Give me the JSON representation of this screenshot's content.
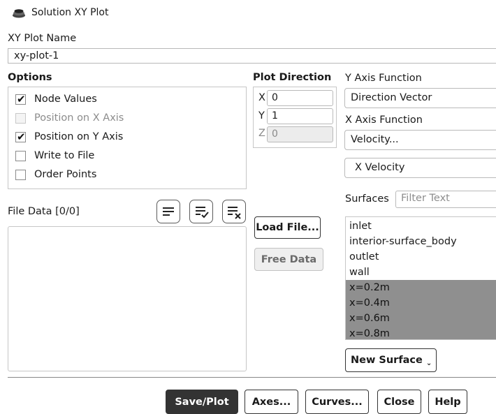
{
  "window": {
    "title": "Solution XY Plot"
  },
  "name": {
    "label": "XY Plot Name",
    "value": "xy-plot-1"
  },
  "options": {
    "title": "Options",
    "items": [
      {
        "label": "Node Values",
        "checked": true,
        "enabled": true
      },
      {
        "label": "Position on X Axis",
        "checked": false,
        "enabled": false
      },
      {
        "label": "Position on Y Axis",
        "checked": true,
        "enabled": true
      },
      {
        "label": "Write to File",
        "checked": false,
        "enabled": true
      },
      {
        "label": "Order Points",
        "checked": false,
        "enabled": true
      }
    ]
  },
  "plot_direction": {
    "title": "Plot Direction",
    "x": {
      "label": "X",
      "value": "0"
    },
    "y": {
      "label": "Y",
      "value": "1"
    },
    "z": {
      "label": "Z",
      "value": "0"
    }
  },
  "y_axis": {
    "label": "Y Axis Function",
    "value": "Direction Vector"
  },
  "x_axis": {
    "label": "X Axis Function",
    "value": "Velocity...",
    "sub_value": "X Velocity"
  },
  "surfaces": {
    "label": "Surfaces",
    "filter_placeholder": "Filter Text",
    "items": [
      {
        "label": "inlet",
        "selected": false
      },
      {
        "label": "interior-surface_body",
        "selected": false
      },
      {
        "label": "outlet",
        "selected": false
      },
      {
        "label": "wall",
        "selected": false
      },
      {
        "label": "x=0.2m",
        "selected": true
      },
      {
        "label": "x=0.4m",
        "selected": true
      },
      {
        "label": "x=0.6m",
        "selected": true
      },
      {
        "label": "x=0.8m",
        "selected": true
      }
    ],
    "new_surface": "New Surface"
  },
  "file_data": {
    "label": "File Data [0/0]",
    "load": "Load File...",
    "free": "Free Data"
  },
  "footer": {
    "save_plot": "Save/Plot",
    "axes": "Axes...",
    "curves": "Curves...",
    "close": "Close",
    "help": "Help"
  },
  "colors": {
    "selected_row": "#8f8f8f",
    "primary_button": "#333333"
  }
}
